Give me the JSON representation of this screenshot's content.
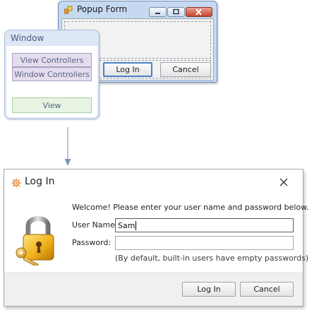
{
  "popup": {
    "title": "Popup Form",
    "login_button": "Log In",
    "cancel_button": "Cancel"
  },
  "window_panel": {
    "title": "Window",
    "view_controllers": "View Controllers",
    "window_controllers": "Window Controllers",
    "view": "View"
  },
  "login_dialog": {
    "title": "Log In",
    "welcome": "Welcome! Please enter your user name and password below.",
    "username_label": "User Name:",
    "username_value": "Sam",
    "password_label": "Password:",
    "password_value": "",
    "hint": "(By default, built-in users have empty passwords)",
    "login_button": "Log In",
    "cancel_button": "Cancel"
  },
  "colors": {
    "controllers_fill": "#e5dcee",
    "view_fill": "#e7f3e3",
    "window_panel_fill": "#dde7f5",
    "arrow": "#8aa0bd"
  },
  "icons": [
    "app-icon",
    "minimize-icon",
    "maximize-icon",
    "close-icon",
    "gear-icon",
    "padlock-icon",
    "arrow-down-icon"
  ]
}
